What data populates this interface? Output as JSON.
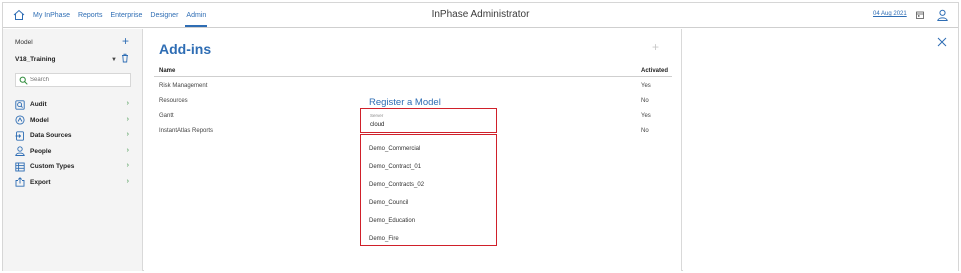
{
  "topbar": {
    "nav": [
      "My InPhase",
      "Reports",
      "Enterprise",
      "Designer",
      "Admin"
    ],
    "active": "Admin",
    "title": "InPhase Administrator",
    "date": "04 Aug 2021"
  },
  "sidebar": {
    "model_label": "Model",
    "model_value": "V18_Training",
    "search_placeholder": "Search",
    "items": [
      {
        "label": "Audit",
        "icon": "audit-icon"
      },
      {
        "label": "Model",
        "icon": "model-icon"
      },
      {
        "label": "Data Sources",
        "icon": "data-sources-icon"
      },
      {
        "label": "People",
        "icon": "people-icon"
      },
      {
        "label": "Custom Types",
        "icon": "custom-types-icon"
      },
      {
        "label": "Export",
        "icon": "export-icon"
      }
    ]
  },
  "main": {
    "title": "Add-ins",
    "columns": {
      "name": "Name",
      "activated": "Activated"
    },
    "rows": [
      {
        "name": "Risk Management",
        "activated": "Yes"
      },
      {
        "name": "Resources",
        "activated": "No"
      },
      {
        "name": "Gantt",
        "activated": "Yes"
      },
      {
        "name": "InstantAtlas Reports",
        "activated": "No"
      }
    ]
  },
  "register": {
    "title": "Register a Model",
    "server_label": "Server",
    "server_value": "cloud",
    "models": [
      "Demo_Commercial",
      "Demo_Contract_01",
      "Demo_Contracts_02",
      "Demo_Council",
      "Demo_Education",
      "Demo_Fire"
    ]
  },
  "colors": {
    "accent": "#2e6db4",
    "highlight": "#d0202a",
    "chevron": "#2e8b3a"
  }
}
